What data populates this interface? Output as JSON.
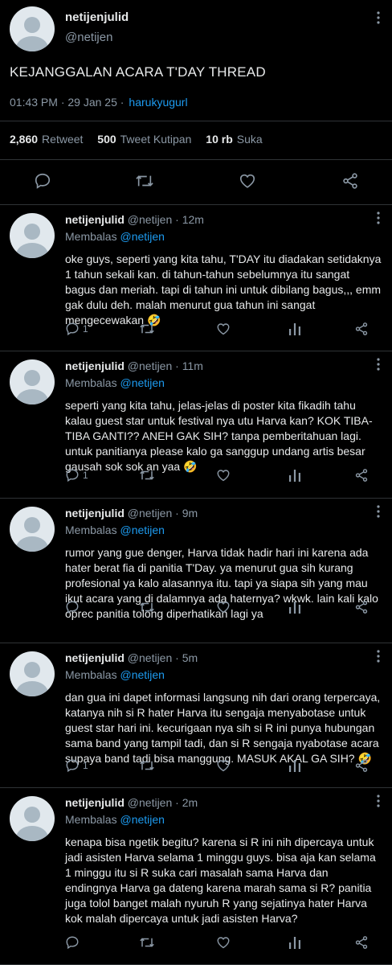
{
  "tweet": {
    "name": "netijenjulid",
    "handle": "@netijen",
    "text": "KEJANGGALAN ACARA T'DAY THREAD",
    "time": "01:43 PM · 29 Jan 25 ·",
    "client": "harukyugurl",
    "stats": {
      "retweets_count": "2,860",
      "retweets_label": "Retweet",
      "quotes_count": "500",
      "quotes_label": "Tweet Kutipan",
      "likes_count": "10 rb",
      "likes_label": "Suka"
    }
  },
  "replies": [
    {
      "name": "netijenjulid",
      "handle_time": "@netijen · 12m",
      "reply_to_label": "Membalas",
      "reply_to_handle": "@netijen",
      "text": "oke guys, seperti yang kita tahu, T'DAY itu diadakan setidaknya 1 tahun sekali kan. di tahun-tahun sebelumnya itu sangat bagus dan meriah. tapi di tahun ini untuk dibilang bagus,,, emm gak dulu deh. malah menurut gua tahun ini sangat mengecewakan 🤣",
      "reply_count": "1"
    },
    {
      "name": "netijenjulid",
      "handle_time": "@netijen · 11m",
      "reply_to_label": "Membalas",
      "reply_to_handle": "@netijen",
      "text": "seperti yang kita tahu, jelas-jelas di poster kita fikadih tahu kalau guest star untuk festival nya utu Harva kan? KOK TIBA-TIBA GANTI?? ANEH GAK SIH? tanpa pemberitahuan lagi. untuk panitianya please kalo ga sanggup undang artis besar gausah sok sok an yaa 🤣",
      "reply_count": "1"
    },
    {
      "name": "netijenjulid",
      "handle_time": "@netijen · 9m",
      "reply_to_label": "Membalas",
      "reply_to_handle": "@netijen",
      "text": "rumor yang gue denger, Harva tidak hadir hari ini karena ada hater berat fia di panitia T'Day. ya menurut gua sih kurang profesional ya kalo alasannya itu. tapi ya siapa sih yang mau ikut acara yang di dalamnya ada haternya? wkwk. lain kali kalo oprec panitia tolong diperhatikan lagi ya",
      "reply_count": ""
    },
    {
      "name": "netijenjulid",
      "handle_time": "@netijen · 5m",
      "reply_to_label": "Membalas",
      "reply_to_handle": "@netijen",
      "text": "dan gua ini dapet informasi langsung nih dari orang terpercaya, katanya nih si R hater Harva itu sengaja menyabotase untuk guest star hari ini. kecurigaan nya sih si R ini punya hubungan sama band yang tampil tadi, dan si R sengaja nyabotase acara supaya band tadi bisa manggung. MASUK AKAL GA SIH? 🤣",
      "reply_count": "1"
    },
    {
      "name": "netijenjulid",
      "handle_time": "@netijen · 2m",
      "reply_to_label": "Membalas",
      "reply_to_handle": "@netijen",
      "text": "kenapa bisa ngetik begitu? karena si R ini nih dipercaya untuk jadi asisten Harva selama 1 minggu guys. bisa aja kan selama 1 minggu itu si R suka cari masalah sama Harva dan endingnya Harva ga dateng karena marah sama si R? panitia juga tolol banget malah nyuruh R yang sejatinya hater Harva kok malah dipercaya untuk jadi asisten Harva?",
      "reply_count": ""
    }
  ],
  "icons": [
    "reply-icon",
    "retweet-icon",
    "like-icon",
    "share-icon",
    "stats-icon",
    "more-icon"
  ]
}
